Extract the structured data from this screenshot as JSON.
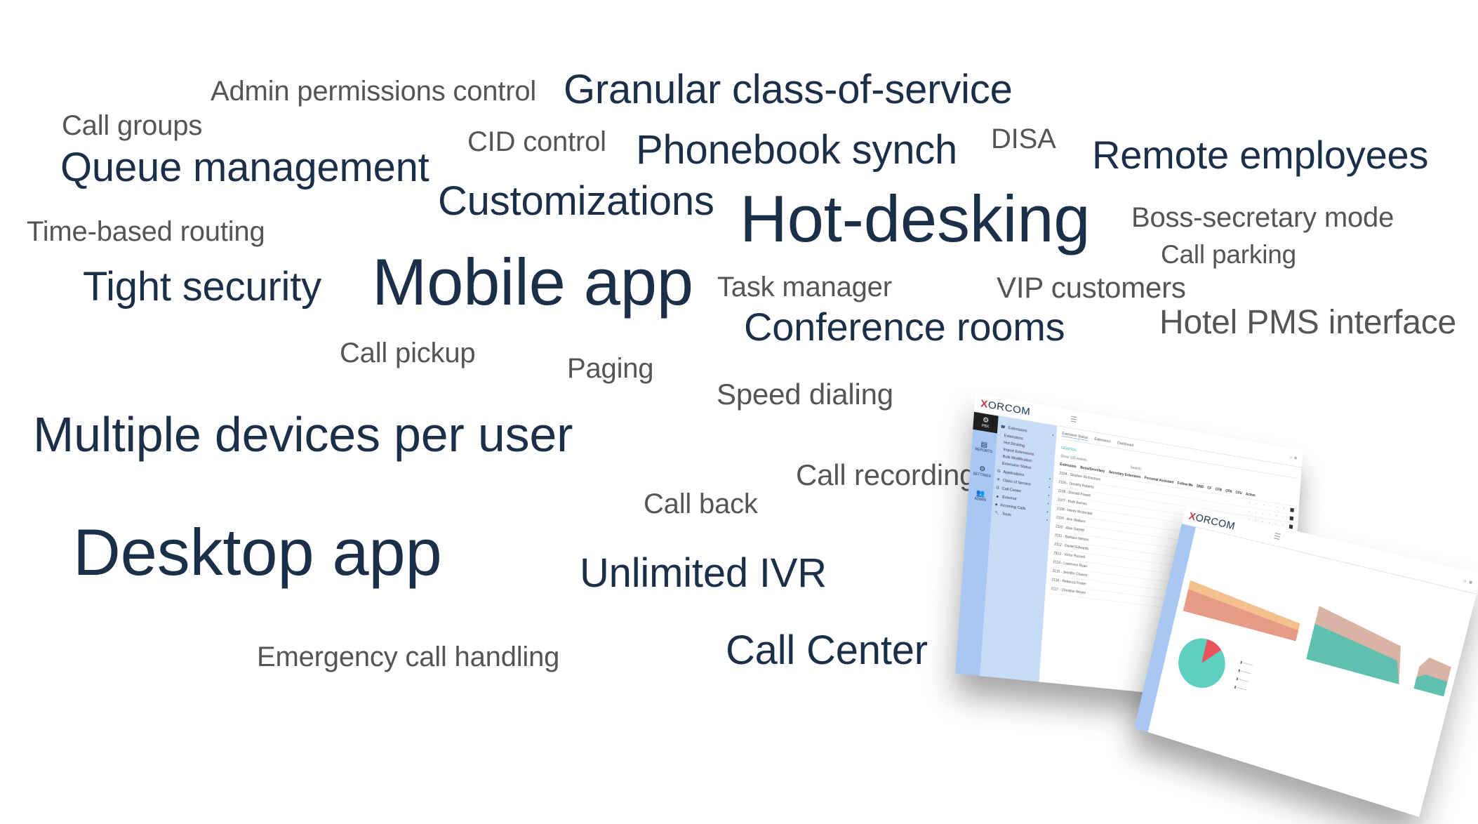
{
  "word_cloud": {
    "colors": {
      "emphasis": "#1b3048",
      "secondary": "#555555"
    },
    "words": [
      {
        "text": "Admin permissions control",
        "tone": "secondary"
      },
      {
        "text": "Granular class-of-service",
        "tone": "emphasis"
      },
      {
        "text": "Call groups",
        "tone": "secondary"
      },
      {
        "text": "CID control",
        "tone": "secondary"
      },
      {
        "text": "Phonebook synch",
        "tone": "emphasis"
      },
      {
        "text": "DISA",
        "tone": "secondary"
      },
      {
        "text": "Remote employees",
        "tone": "emphasis"
      },
      {
        "text": "Queue management",
        "tone": "emphasis"
      },
      {
        "text": "Customizations",
        "tone": "emphasis"
      },
      {
        "text": "Hot-desking",
        "tone": "emphasis"
      },
      {
        "text": "Boss-secretary mode",
        "tone": "secondary"
      },
      {
        "text": "Time-based routing",
        "tone": "secondary"
      },
      {
        "text": "Call parking",
        "tone": "secondary"
      },
      {
        "text": "Tight security",
        "tone": "emphasis"
      },
      {
        "text": "Mobile app",
        "tone": "emphasis"
      },
      {
        "text": "Task manager",
        "tone": "secondary"
      },
      {
        "text": "VIP customers",
        "tone": "secondary"
      },
      {
        "text": "Conference rooms",
        "tone": "emphasis"
      },
      {
        "text": "Hotel PMS interface",
        "tone": "secondary"
      },
      {
        "text": "Call pickup",
        "tone": "secondary"
      },
      {
        "text": "Paging",
        "tone": "secondary"
      },
      {
        "text": "Speed dialing",
        "tone": "secondary"
      },
      {
        "text": "Multiple devices per user",
        "tone": "emphasis"
      },
      {
        "text": "Call recording",
        "tone": "secondary"
      },
      {
        "text": "Call back",
        "tone": "secondary"
      },
      {
        "text": "Desktop app",
        "tone": "emphasis"
      },
      {
        "text": "Unlimited IVR",
        "tone": "emphasis"
      },
      {
        "text": "Emergency call handling",
        "tone": "secondary"
      },
      {
        "text": "Call Center",
        "tone": "emphasis"
      }
    ]
  },
  "inset_screens": {
    "pbx_admin": {
      "logo": {
        "mark": "X",
        "text": "ORCOM"
      },
      "rail": [
        {
          "label": "PBX",
          "icon": "gear-icon",
          "active": true
        },
        {
          "label": "REPORTS",
          "icon": "report-icon"
        },
        {
          "label": "SETTINGS",
          "icon": "settings-icon"
        },
        {
          "label": "ADMIN",
          "icon": "users-icon"
        }
      ],
      "nav": {
        "extensions": "Extensions",
        "extension_items": [
          "Extensions",
          "Hot Desking",
          "Import Extensions",
          "Bulk Modification",
          "Extension Status"
        ],
        "groups": [
          "Applications",
          "Class of Service",
          "Call Center",
          "External",
          "Incoming Calls",
          "Tools"
        ]
      },
      "tabs": [
        "Extension Status",
        "Extensions",
        "Dashboard"
      ],
      "section": "GENERAL",
      "show_label": "Show",
      "show_value": "100",
      "show_suffix": "entries",
      "search_label": "Search:",
      "columns": [
        "Extension",
        "Boss/Secretary",
        "Secretary Extension",
        "Personal Assistant",
        "Follow Me",
        "DND",
        "CF",
        "CFB",
        "CFN",
        "CFU",
        "Action"
      ],
      "rows": [
        "2104 - Stephen Richardson",
        "2105 - Dorothy Roberts",
        "2106 - Donald Powell",
        "2107 - Ruth Barnes",
        "2108 - Henry Mcdonald",
        "2109 - Ann Wallace",
        "2110 - Alan Garrett",
        "2111 - Barbara Nelson",
        "2112 - Daniel Edwards",
        "2113 - Victor Russell",
        "2114 - Lawrence Ryan",
        "2115 - Jennifer Chavez",
        "2116 - Rebecca Foster",
        "2117 - Christine Reyes"
      ]
    },
    "dashboard": {
      "logo": {
        "mark": "X",
        "text": "ORCOM"
      },
      "pie_share": [
        0.12,
        0.88
      ],
      "colors": {
        "pie_a": "#e9545f",
        "pie_b": "#5fcfc0",
        "area_a": "#f4c08d",
        "area_b": "#e79a86",
        "area_c": "#5fbfb0"
      }
    }
  }
}
